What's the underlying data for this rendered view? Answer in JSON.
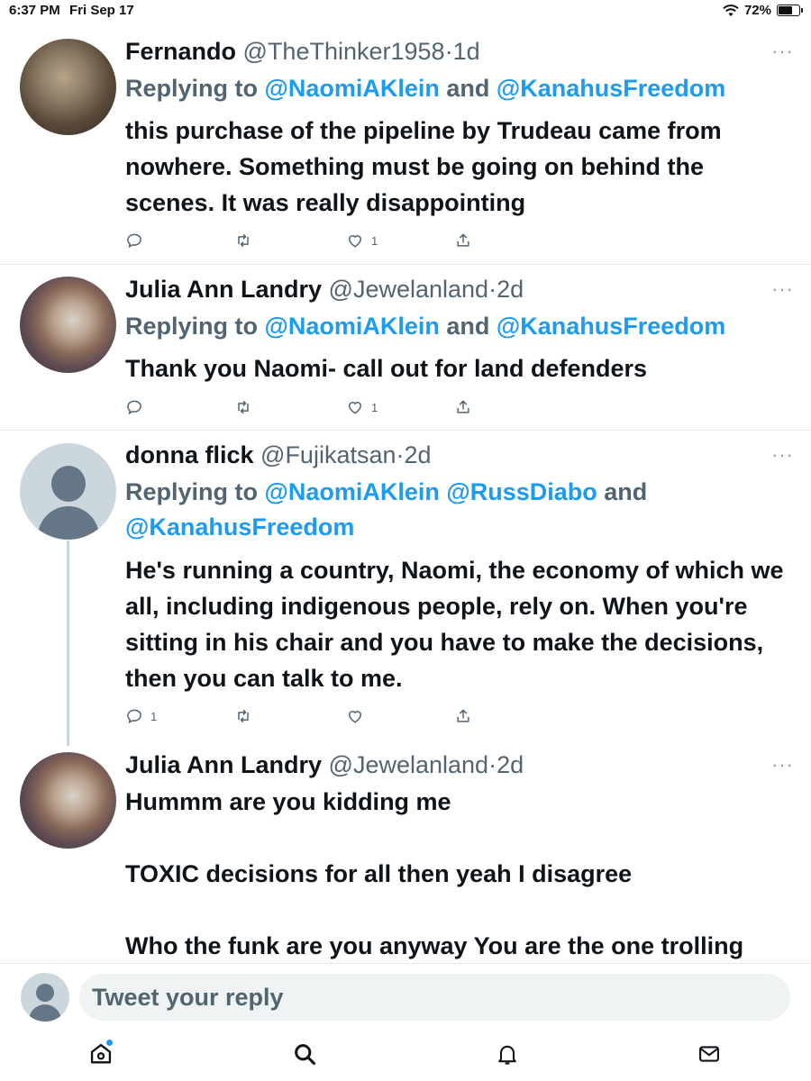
{
  "status_bar": {
    "time": "6:37 PM",
    "date": "Fri Sep 17",
    "battery": "72%",
    "battery_level": 0.72
  },
  "tweets": [
    {
      "name": "Fernando",
      "handle": "@TheThinker1958",
      "sep": "·",
      "age": "1d",
      "reply_prefix": "Replying to ",
      "mentions": [
        "@NaomiAKlein",
        "@KanahusFreedom"
      ],
      "joiner": " and ",
      "text": "this purchase of the pipeline by Trudeau came from nowhere. Something must be going on behind the scenes. It was really disappointing",
      "reply_count": "",
      "like_count": "1"
    },
    {
      "name": "Julia Ann Landry",
      "handle": "@Jewelanland",
      "sep": "·",
      "age": "2d",
      "reply_prefix": "Replying to ",
      "mentions": [
        "@NaomiAKlein",
        "@KanahusFreedom"
      ],
      "joiner": " and ",
      "text": "Thank you Naomi- call out for land defenders",
      "reply_count": "",
      "like_count": "1"
    },
    {
      "name": "donna flick",
      "handle": "@Fujikatsan",
      "sep": "·",
      "age": "2d",
      "reply_prefix": "Replying to ",
      "mentions": [
        "@NaomiAKlein",
        "@RussDiabo",
        "@KanahusFreedom"
      ],
      "joiner": " and ",
      "text": "He's running a country, Naomi, the economy of which we all, including indigenous people, rely on. When you're sitting in his chair and you have to make the decisions, then you can talk to me.",
      "reply_count": "1",
      "like_count": ""
    },
    {
      "name": "Julia Ann Landry",
      "handle": "@Jewelanland",
      "sep": "·",
      "age": "2d",
      "text_lines": [
        "Hummm are you kidding me",
        "TOXIC decisions for all then yeah I disagree",
        "Who the funk are you anyway You are the one trolling"
      ]
    }
  ],
  "reply_bar": {
    "placeholder": "Tweet your reply"
  },
  "nav": [
    "home-icon",
    "search-icon",
    "notifications-icon",
    "messages-icon"
  ],
  "colors": {
    "link": "#1d9bf0",
    "muted": "#536471",
    "text": "#0f1419"
  }
}
